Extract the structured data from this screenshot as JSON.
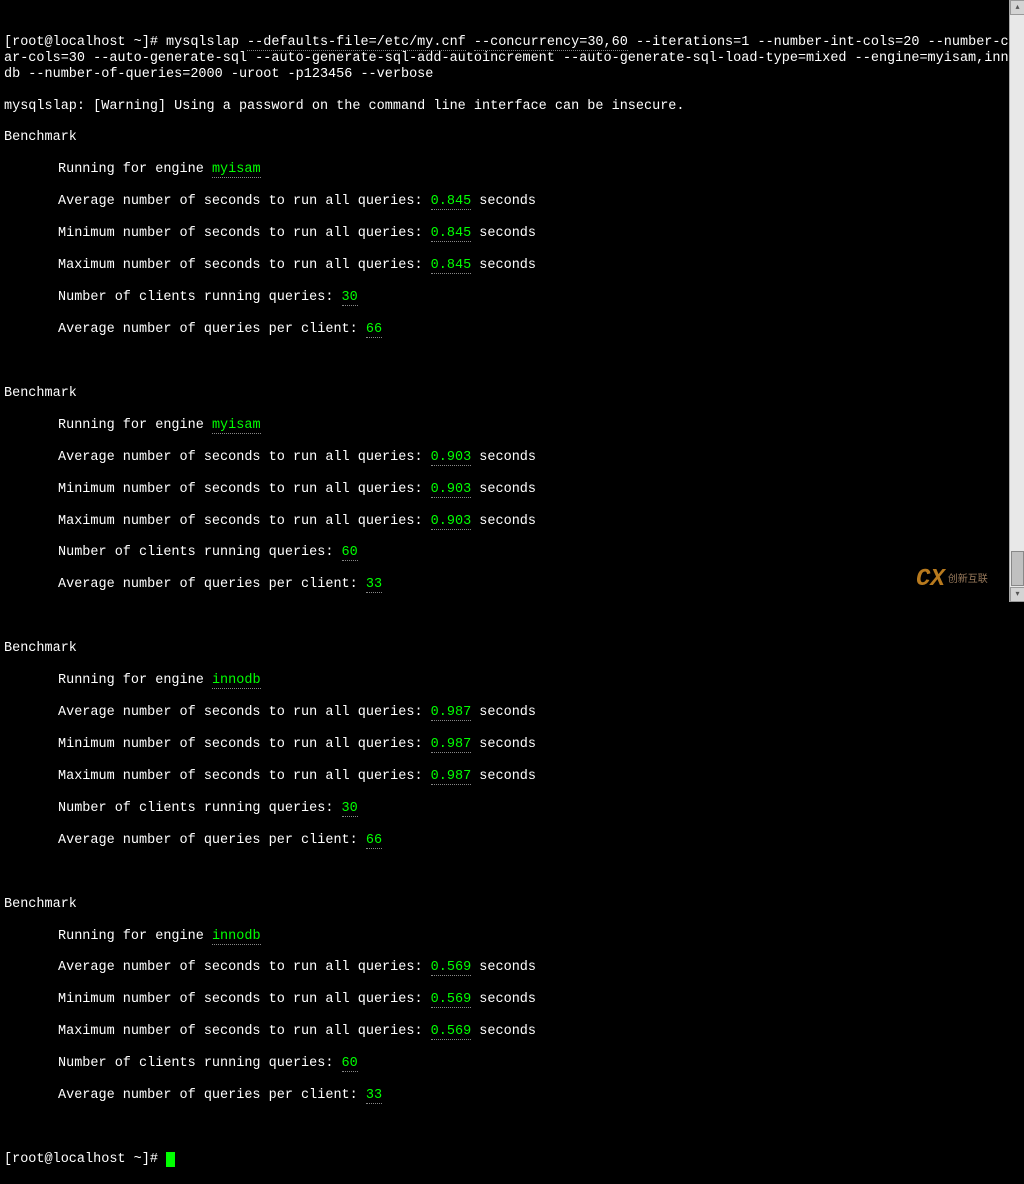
{
  "prompt": "[root@localhost ~]# ",
  "command": "mysqlslap --defaults-file=/etc/my.cnf --concurrency=30,60 --iterations=1 --number-int-cols=20 --number-char-cols=30 --auto-generate-sql --auto-generate-sql-add-autoincrement --auto-generate-sql-load-type=mixed --engine=myisam,innodb --number-of-queries=2000 -uroot -p123456 --verbose",
  "command_highlights": [
    "--defaults-file=/etc/my.cnf",
    "--concurrency=30,60"
  ],
  "warning": "mysqlslap: [Warning] Using a password on the command line interface can be insecure.",
  "benchmark_label": "Benchmark",
  "running_prefix": "Running for engine ",
  "avg_seconds_label": "Average number of seconds to run all queries: ",
  "min_seconds_label": "Minimum number of seconds to run all queries: ",
  "max_seconds_label": "Maximum number of seconds to run all queries: ",
  "clients_label": "Number of clients running queries: ",
  "queries_per_client_label": "Average number of queries per client: ",
  "seconds_suffix": " seconds",
  "benchmarks": [
    {
      "engine": "myisam",
      "avg": "0.845",
      "min": "0.845",
      "max": "0.845",
      "clients": "30",
      "qpc": "66"
    },
    {
      "engine": "myisam",
      "avg": "0.903",
      "min": "0.903",
      "max": "0.903",
      "clients": "60",
      "qpc": "33"
    },
    {
      "engine": "innodb",
      "avg": "0.987",
      "min": "0.987",
      "max": "0.987",
      "clients": "30",
      "qpc": "66"
    },
    {
      "engine": "innodb",
      "avg": "0.569",
      "min": "0.569",
      "max": "0.569",
      "clients": "60",
      "qpc": "33"
    }
  ],
  "watermark": {
    "logo": "CX",
    "text": "创新互联"
  }
}
